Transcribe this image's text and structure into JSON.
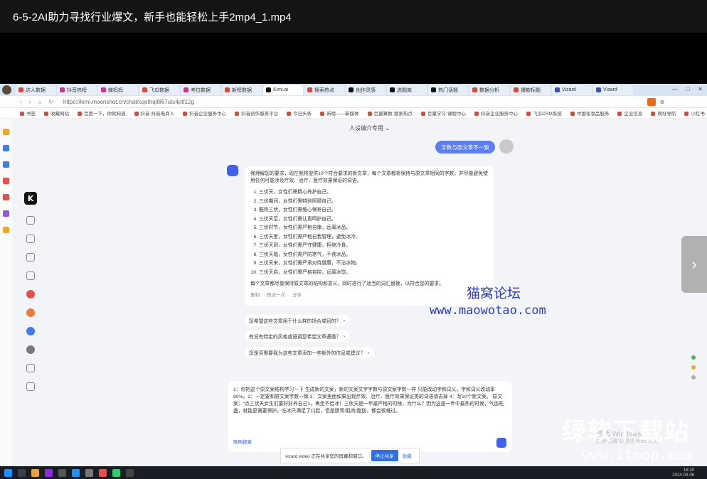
{
  "player": {
    "title": "6-5-2AI助力寻找行业爆文，新手也能轻松上手2mp4_1.mp4"
  },
  "browser": {
    "tabs": [
      {
        "label": "达人数据",
        "color": "#d64a3a"
      },
      {
        "label": "抖音热榜",
        "color": "#c9388f"
      },
      {
        "label": "蝉妈妈",
        "color": "#c9388f"
      },
      {
        "label": "飞瓜数据",
        "color": "#d64a3a"
      },
      {
        "label": "考拉数据",
        "color": "#c9388f"
      },
      {
        "label": "新榜数据",
        "color": "#d64a3a"
      },
      {
        "label": "Kimi.ai",
        "color": "#111111"
      },
      {
        "label": "搜索热点",
        "color": "#d64a3a"
      },
      {
        "label": "创作灵感",
        "color": "#111111"
      },
      {
        "label": "选题库",
        "color": "#111111"
      },
      {
        "label": "热门话题",
        "color": "#111111"
      },
      {
        "label": "数据分析",
        "color": "#d64a3a"
      },
      {
        "label": "爆款标题",
        "color": "#d64a3a"
      },
      {
        "label": "Vizard",
        "color": "#3b4fc2"
      },
      {
        "label": "Vizard",
        "color": "#3b4fc2"
      }
    ],
    "url": "https://kimi.moonshot.cn/chat/cqothql8l67utc4ptf12g",
    "bookmarks": [
      "书签",
      "收藏网站",
      "百度一下，你就知道",
      "抖音·抖音电商人",
      "抖音企业服务中心",
      "抖音创作服务平台",
      "今日头条",
      "新榜——新媒体",
      "巨量算数-搜索热点",
      "巨量学习-课程中心",
      "抖音企业服务中心",
      "飞瓜CRM系统",
      "中国化妆品服务",
      "企业信息",
      "网址导航",
      "小红书",
      "问题反馈"
    ]
  },
  "kimi": {
    "mode_label": "人设编介专用 ⌄",
    "user_message": "字数与原文章不一致",
    "answer_intro": "我理解您的要求，现在我将提供10个符合要求的新文章，每个文章都将保持与原文章相同的字数，并尽量避免使用任何可能涉及疗效、治疗、医疗效果保证的词语。",
    "answer_items": [
      "三伏天，女性们需精心养护自己。",
      "三伏期间，女性们需特别照顾自己。",
      "酷热三伏，女性们需细心保养自己。",
      "三伏天至，女性们需认真呵护自己。",
      "三伏时节，女性们需严格自律，远离冰品。",
      "三伏天里，女性们需严格自我管理，避免冰冷。",
      "三伏天到，女性们需严守健康，拒绝冷食。",
      "三伏天临，女性们需严防寒气，不食冰品。",
      "三伏天来，女性们需严肃对待健康，不沾冰物。",
      "三伏天启，女性们需严格自控，远离冰饮。"
    ],
    "answer_outro": "每个文章都尽量保持原文章的结构和意义，同时进行了适当的词汇替换，以符合您的要求。",
    "actions": [
      "复制",
      "再试一次",
      "分享"
    ],
    "suggestions": [
      "您希望这些文章用于什么样的场合或目的？",
      "有没有特定的风格或语调您希望文章遵循？",
      "您是否需要我为这些文章添加一些额外的信息或建议？"
    ],
    "input_text": "1：你把这个原文案结构学习一下 生成新的文案，新的文案文字字数与原文案字数一样 只能改动字和词义，字和词义改动率80%。2：一定要和原文案字数一致 3：文案里面如果出现疗效、治疗、医疗效果保证类的词语请去掉 4：写10个新文案。 原文案：\"点三伏天女生们要好好养自己1，再坐不给冰！三伏天是一年最严格的时候，为什么？因为这是一年中最热的时候，气血旺盛，就能更需要保护，吃冰只满足了口腔，但是肠胃/肌肉/脂肪，都会很难过。",
    "web_search": "联网搜索"
  },
  "overlay": {
    "watermark_cn": "猫窝论坛",
    "watermark_url": "www.maowotao.com",
    "share_text": "vizard.video 正在共享您的屏幕和窗口。",
    "share_stop": "停止共享",
    "share_hide": "隐藏",
    "windows_activate": "激活 Windows",
    "windows_activate_sub": "转到\"设置\"以激活 Windows。",
    "site_brand": "绿软下载站",
    "site_url": "www.itmop.com",
    "clock_time": "18:20",
    "clock_date": "2024-08-06"
  }
}
